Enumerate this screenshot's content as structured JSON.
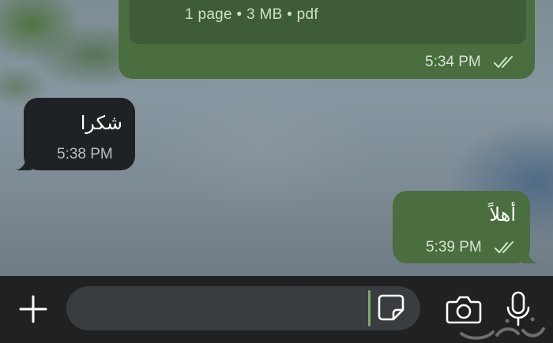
{
  "messages": [
    {
      "direction": "outgoing",
      "attachment": {
        "meta": "1 page • 3 MB • pdf"
      },
      "time": "5:34 PM",
      "status": "read"
    },
    {
      "direction": "incoming",
      "text": "شكرا",
      "time": "5:38 PM"
    },
    {
      "direction": "outgoing",
      "text": "أهلاً",
      "time": "5:39 PM",
      "status": "read"
    }
  ],
  "composer": {
    "placeholder": "",
    "plus_icon": "plus-icon",
    "sticker_icon": "sticker-icon",
    "camera_icon": "camera-icon",
    "mic_icon": "microphone-icon"
  },
  "watermark": {
    "text": "حراج",
    "icon": "watermark-logo"
  },
  "colors": {
    "outgoing_bubble": "#4a6e3f",
    "incoming_bubble": "#1f2224",
    "input_bar": "#1f2122",
    "input_field": "#3a3d40",
    "caret": "#7fa86e"
  }
}
